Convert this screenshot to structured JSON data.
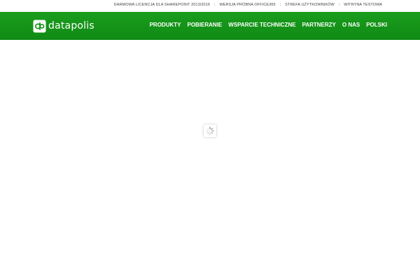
{
  "top_links": [
    {
      "label": "DARMOWA LICENCJA DLA SHAREPOINT 2013/2016"
    },
    {
      "label": "WERSJA PRÓBNA OFFICE365"
    },
    {
      "label": "STREFA UŻYTKOWNIKÓW"
    },
    {
      "label": "WITRYNA TESTOWA"
    }
  ],
  "top_separator": "|",
  "brand": {
    "name": "datapolis",
    "logo_icon": "datapolis-logo-icon"
  },
  "nav": [
    {
      "label": "PRODUKTY"
    },
    {
      "label": "POBIERANIE"
    },
    {
      "label": "WSPARCIE TECHNICZNE"
    },
    {
      "label": "PARTNERZY"
    },
    {
      "label": "O NAS"
    },
    {
      "label": "POLSKI"
    }
  ],
  "loader": {
    "icon": "spinner-icon"
  },
  "colors": {
    "header_green": "#129016",
    "text_white": "#ffffff",
    "top_text": "#444444"
  }
}
